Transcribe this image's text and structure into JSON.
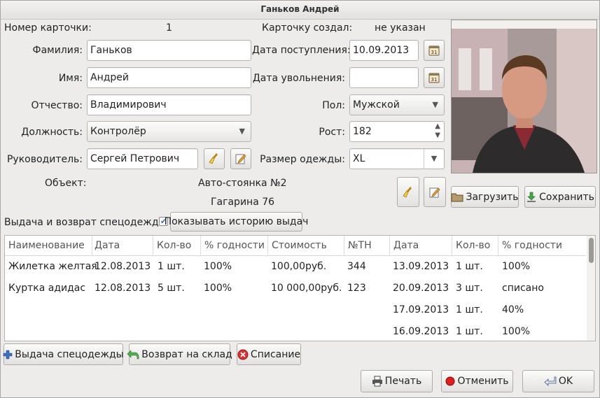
{
  "window": {
    "title": "Ганьков Андрей"
  },
  "card": {
    "number_label": "Номер карточки:",
    "number_value": "1",
    "created_label": "Карточку создал:",
    "created_value": "не указан",
    "surname_label": "Фамилия:",
    "surname_value": "Ганьков",
    "name_label": "Имя:",
    "name_value": "Андрей",
    "patronymic_label": "Отчество:",
    "patronymic_value": "Владимирович",
    "position_label": "Должность:",
    "position_value": "Контролёр",
    "manager_label": "Руководитель:",
    "manager_value": "Сергей Петрович",
    "object_label": "Объект:",
    "object_line1": "Авто-стоянка №2",
    "object_line2": "Гагарина 76",
    "hire_label": "Дата поступления:",
    "hire_value": "10.09.2013",
    "fire_label": "Дата увольнения:",
    "fire_value": "",
    "sex_label": "Пол:",
    "sex_value": "Мужской",
    "height_label": "Рост:",
    "height_value": "182",
    "size_label": "Размер одежды:",
    "size_value": "XL"
  },
  "photo": {
    "load_label": "Загрузить",
    "save_label": "Сохранить"
  },
  "issue": {
    "section_label": "Выдача и возврат спецодежды",
    "history_label": "Показывать историю выдач",
    "history_checked": true
  },
  "table": {
    "headers": [
      "Наименование",
      "Дата",
      "Кол-во",
      "% годности",
      "Стоимость",
      "№ТН",
      "Дата",
      "Кол-во",
      "% годности"
    ],
    "rows": [
      [
        "Жилетка желтая",
        "12.08.2013",
        "1 шт.",
        "100%",
        "100,00руб.",
        "344",
        "13.09.2013",
        "1 шт.",
        "100%"
      ],
      [
        "Куртка адидас",
        "12.08.2013",
        "5 шт.",
        "100%",
        "10 000,00руб.",
        "123",
        "20.09.2013",
        "3 шт.",
        "списано"
      ],
      [
        "",
        "",
        "",
        "",
        "",
        "",
        "17.09.2013",
        "1 шт.",
        "40%"
      ],
      [
        "",
        "",
        "",
        "",
        "",
        "",
        "16.09.2013",
        "1 шт.",
        "100%"
      ]
    ]
  },
  "actions": {
    "issue": "Выдача спецодежды",
    "return": "Возврат на склад",
    "writeoff": "Списание"
  },
  "dialog": {
    "print": "Печать",
    "cancel": "Отменить",
    "ok": "OK"
  }
}
